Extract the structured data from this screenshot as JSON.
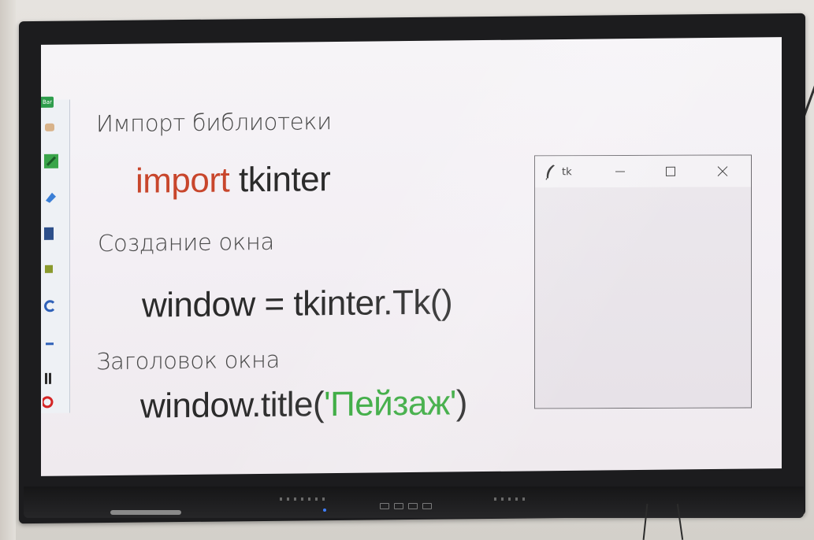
{
  "slide": {
    "heading_import": "Импорт библиотеки",
    "code_import_keyword": "import",
    "code_import_module": "tkinter",
    "heading_create": "Создание окна",
    "code_create": "window = tkinter.Tk()",
    "heading_title": "Заголовок окна",
    "code_title_prefix": "window.title(",
    "code_title_string": "'Пейзаж'",
    "code_title_suffix": ")"
  },
  "tk_window": {
    "title": "tk",
    "icons": {
      "app": "feather-icon",
      "minimize": "minimize-icon",
      "maximize": "maximize-icon",
      "close": "close-icon"
    }
  },
  "toolbar": {
    "flag_label": "Bar"
  },
  "colors": {
    "keyword": "#c8462c",
    "string": "#34a83a",
    "code_text": "#2b2b2b",
    "heading_text": "#4a4a4a",
    "bezel": "#1c1c1e",
    "screen_bg": "#f4f1f5"
  }
}
